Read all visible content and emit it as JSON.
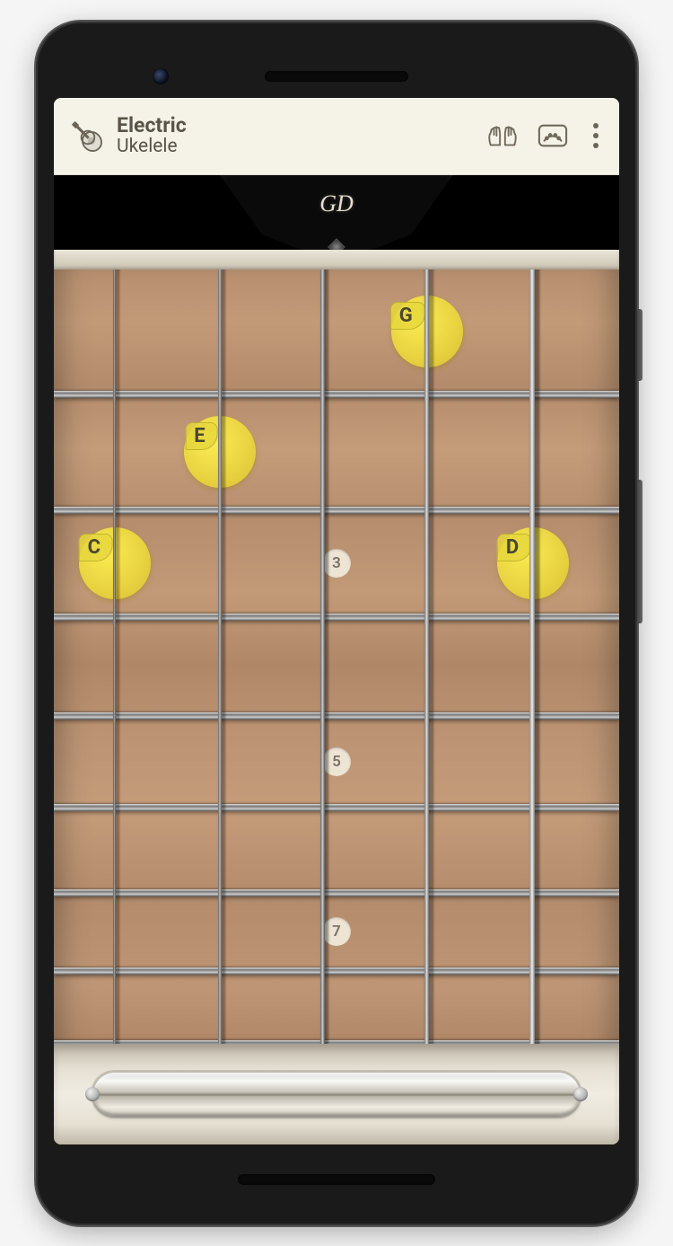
{
  "header": {
    "title": "Electric",
    "subtitle": "Ukelele",
    "logo_text": "GD"
  },
  "fret_markers": [
    {
      "fret": 3,
      "label": "3"
    },
    {
      "fret": 5,
      "label": "5"
    },
    {
      "fret": 7,
      "label": "7"
    }
  ],
  "notes": [
    {
      "label": "G",
      "string": 4,
      "fret": 1
    },
    {
      "label": "E",
      "string": 2,
      "fret": 2
    },
    {
      "label": "C",
      "string": 1,
      "fret": 3
    },
    {
      "label": "D",
      "string": 5,
      "fret": 3
    }
  ],
  "string_count": 5,
  "fret_count": 8
}
